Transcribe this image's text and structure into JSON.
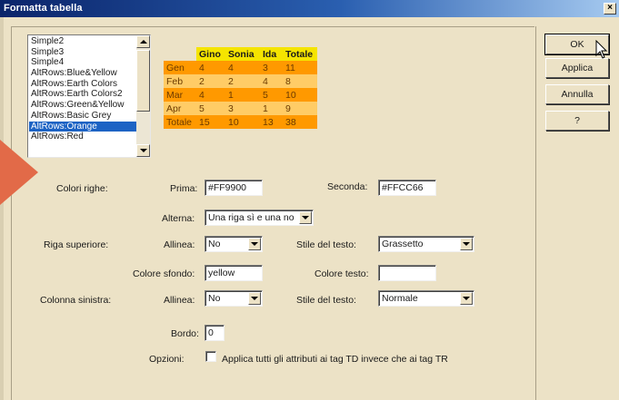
{
  "window": {
    "title": "Formatta tabella",
    "close_glyph": "×"
  },
  "format_list": {
    "items": [
      "Simple2",
      "Simple3",
      "Simple4",
      "AltRows:Blue&Yellow",
      "AltRows:Earth Colors",
      "AltRows:Earth Colors2",
      "AltRows:Green&Yellow",
      "AltRows:Basic Grey",
      "AltRows:Orange",
      "AltRows:Red"
    ],
    "selected": "AltRows:Orange"
  },
  "preview": {
    "headers": [
      "",
      "Gino",
      "Sonia",
      "Ida",
      "Totale"
    ],
    "rows": [
      [
        "Gen",
        "4",
        "4",
        "3",
        "11"
      ],
      [
        "Feb",
        "2",
        "2",
        "4",
        "8"
      ],
      [
        "Mar",
        "4",
        "1",
        "5",
        "10"
      ],
      [
        "Apr",
        "5",
        "3",
        "1",
        "9"
      ],
      [
        "Totale",
        "15",
        "10",
        "13",
        "38"
      ]
    ],
    "colors": {
      "header": "#f5e400",
      "row_first": "#ff9900",
      "row_second": "#ffcc66"
    }
  },
  "rows_section": {
    "label": "Colori righe:",
    "first_label": "Prima:",
    "first_value": "#FF9900",
    "second_label": "Seconda:",
    "second_value": "#FFCC66",
    "alternate_label": "Alterna:",
    "alternate_value": "Una riga sì e una no"
  },
  "top_row_section": {
    "label": "Riga superiore:",
    "align_label": "Allinea:",
    "align_value": "No",
    "text_style_label": "Stile del testo:",
    "text_style_value": "Grassetto",
    "bg_color_label": "Colore sfondo:",
    "bg_color_value": "yellow",
    "text_color_label": "Colore testo:",
    "text_color_value": ""
  },
  "left_column_section": {
    "label": "Colonna sinistra:",
    "align_label": "Allinea:",
    "align_value": "No",
    "text_style_label": "Stile del testo:",
    "text_style_value": "Normale"
  },
  "border": {
    "label": "Bordo:",
    "value": "0"
  },
  "options": {
    "label": "Opzioni:",
    "checkbox_label": "Applica tutti gli attributi ai tag TD invece che ai tag TR",
    "checked": false
  },
  "buttons": {
    "ok": "OK",
    "apply": "Applica",
    "cancel": "Annulla",
    "help": "?"
  },
  "colors": {
    "dialog_bg": "#ece2c6",
    "selection": "#1d63c4",
    "arrow": "#e26a48"
  }
}
